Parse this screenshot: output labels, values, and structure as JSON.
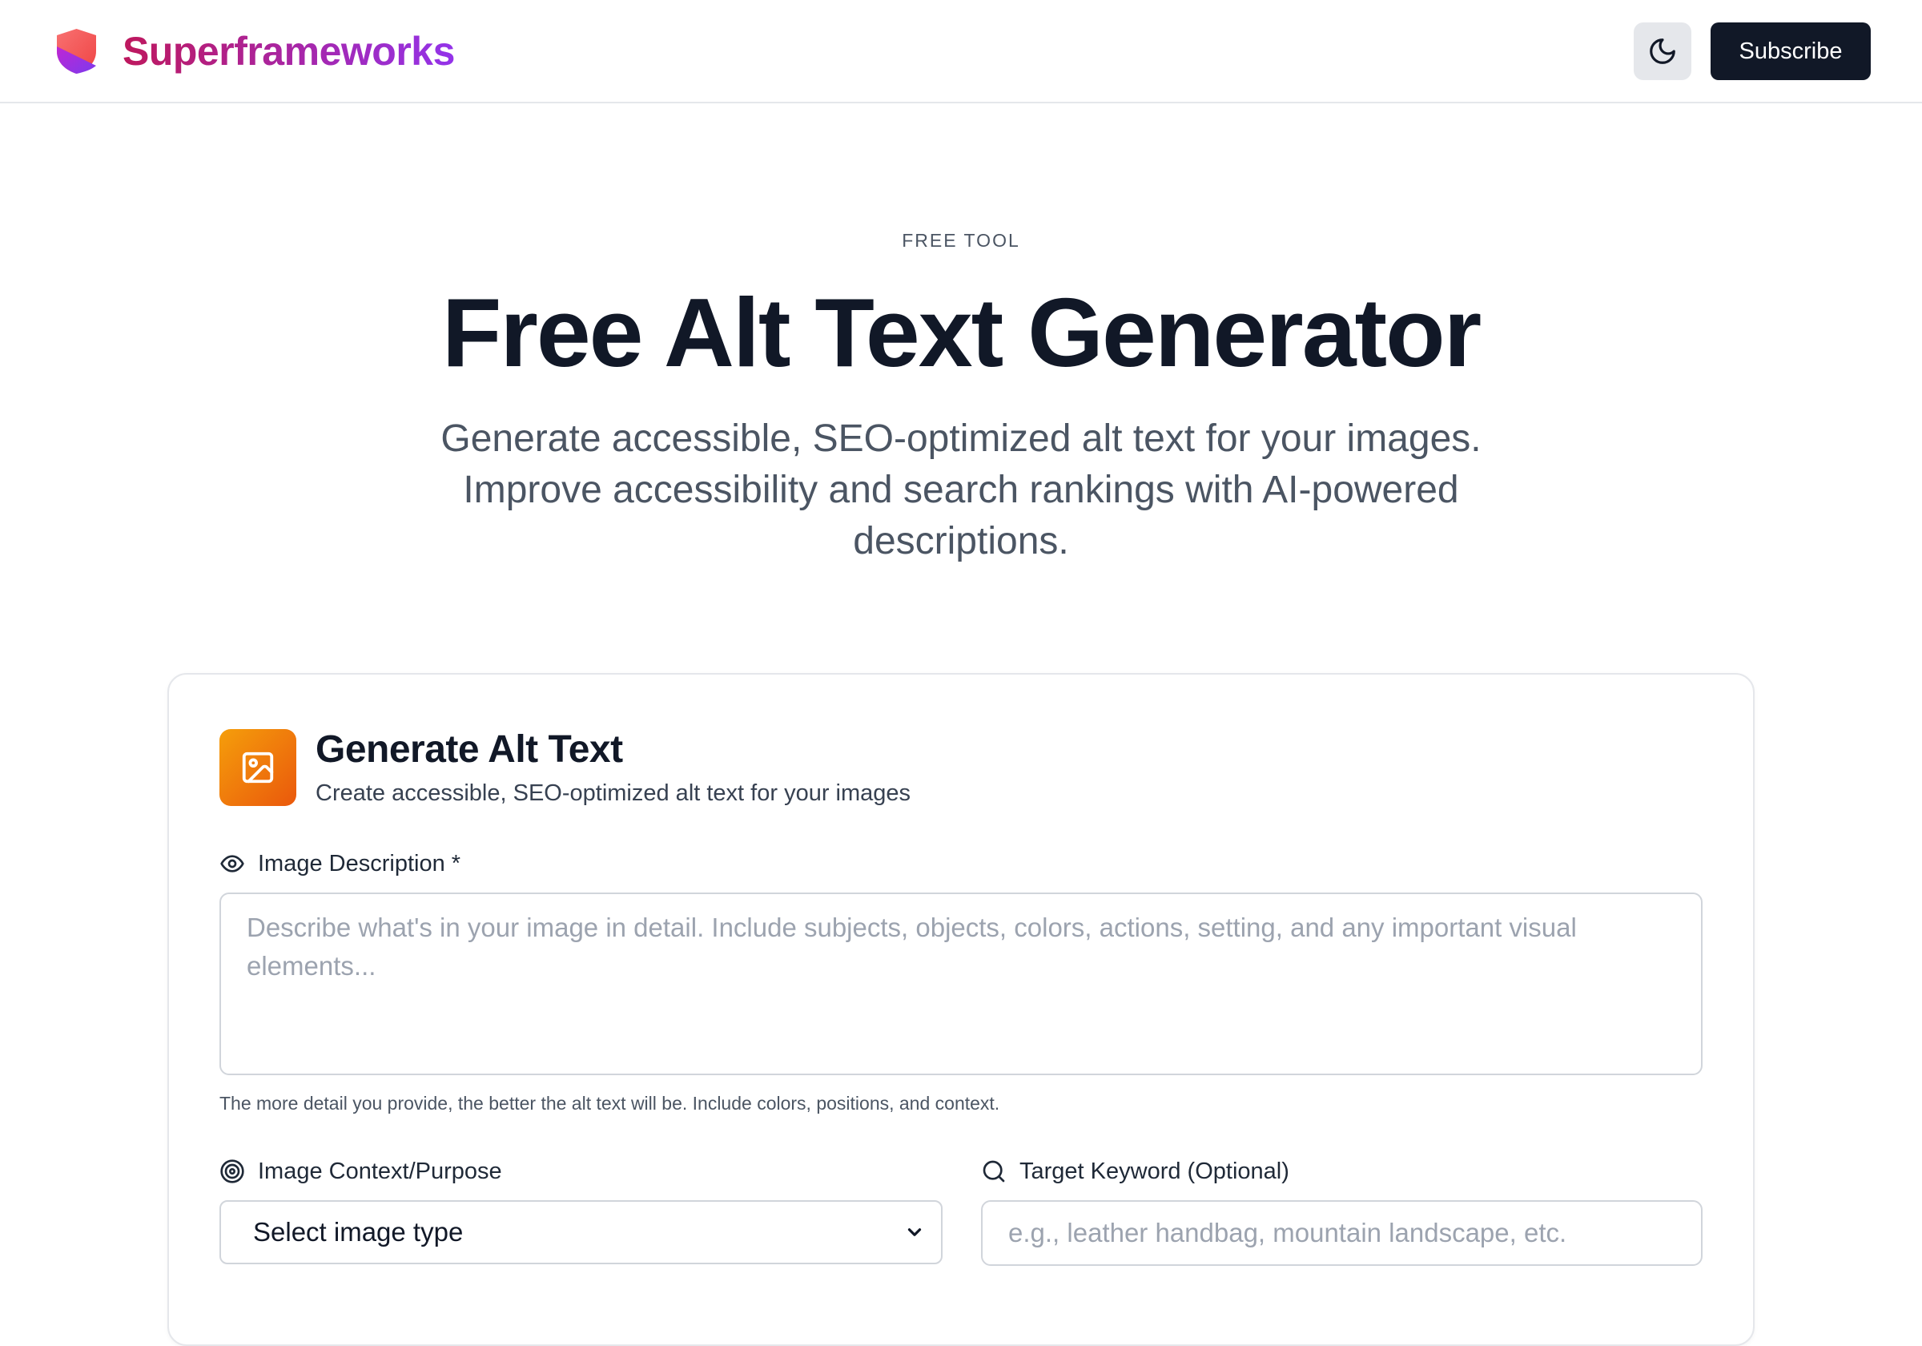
{
  "header": {
    "brand_name": "Superframeworks",
    "theme_toggle_icon": "moon-icon",
    "subscribe_label": "Subscribe"
  },
  "hero": {
    "eyebrow": "FREE TOOL",
    "title": "Free Alt Text Generator",
    "subtitle": "Generate accessible, SEO-optimized alt text for your images. Improve accessibility and search rankings with AI-powered descriptions."
  },
  "card": {
    "icon": "image-icon",
    "title": "Generate Alt Text",
    "subtitle": "Create accessible, SEO-optimized alt text for your images",
    "description_field": {
      "label": "Image Description *",
      "icon": "eye-icon",
      "value": "",
      "placeholder": "Describe what's in your image in detail. Include subjects, objects, colors, actions, setting, and any important visual elements...",
      "hint": "The more detail you provide, the better the alt text will be. Include colors, positions, and context."
    },
    "context_field": {
      "label": "Image Context/Purpose",
      "icon": "target-icon",
      "selected": "Select image type"
    },
    "keyword_field": {
      "label": "Target Keyword (Optional)",
      "icon": "search-icon",
      "value": "",
      "placeholder": "e.g., leather handbag, mountain landscape, etc."
    }
  },
  "colors": {
    "brand_gradient_start": "#be185d",
    "brand_gradient_end": "#9333ea",
    "primary_button": "#111827",
    "card_icon_start": "#f59e0b",
    "card_icon_end": "#ea580c"
  }
}
